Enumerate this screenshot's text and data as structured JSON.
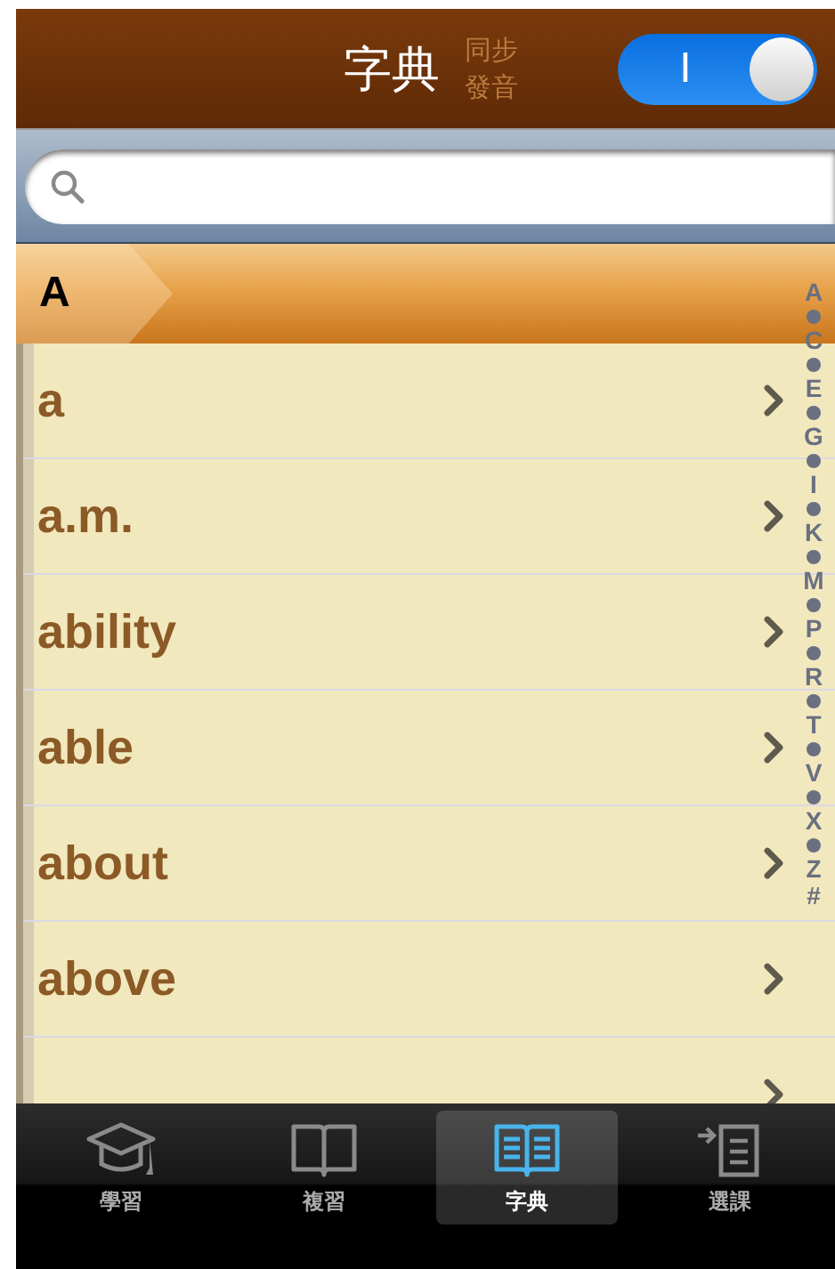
{
  "header": {
    "title": "字典",
    "sync_label": "同步發音",
    "toggle": {
      "label": "I",
      "on": true
    }
  },
  "section": {
    "letter": "A"
  },
  "words": [
    {
      "text": "a"
    },
    {
      "text": "a.m."
    },
    {
      "text": "ability"
    },
    {
      "text": "able"
    },
    {
      "text": "about"
    },
    {
      "text": "above"
    }
  ],
  "index": [
    "A",
    "C",
    "E",
    "G",
    "I",
    "K",
    "M",
    "P",
    "R",
    "T",
    "V",
    "X",
    "Z",
    "#"
  ],
  "tabs": [
    {
      "label": "學習",
      "selected": false
    },
    {
      "label": "複習",
      "selected": false
    },
    {
      "label": "字典",
      "selected": true
    },
    {
      "label": "選課",
      "selected": false
    }
  ]
}
